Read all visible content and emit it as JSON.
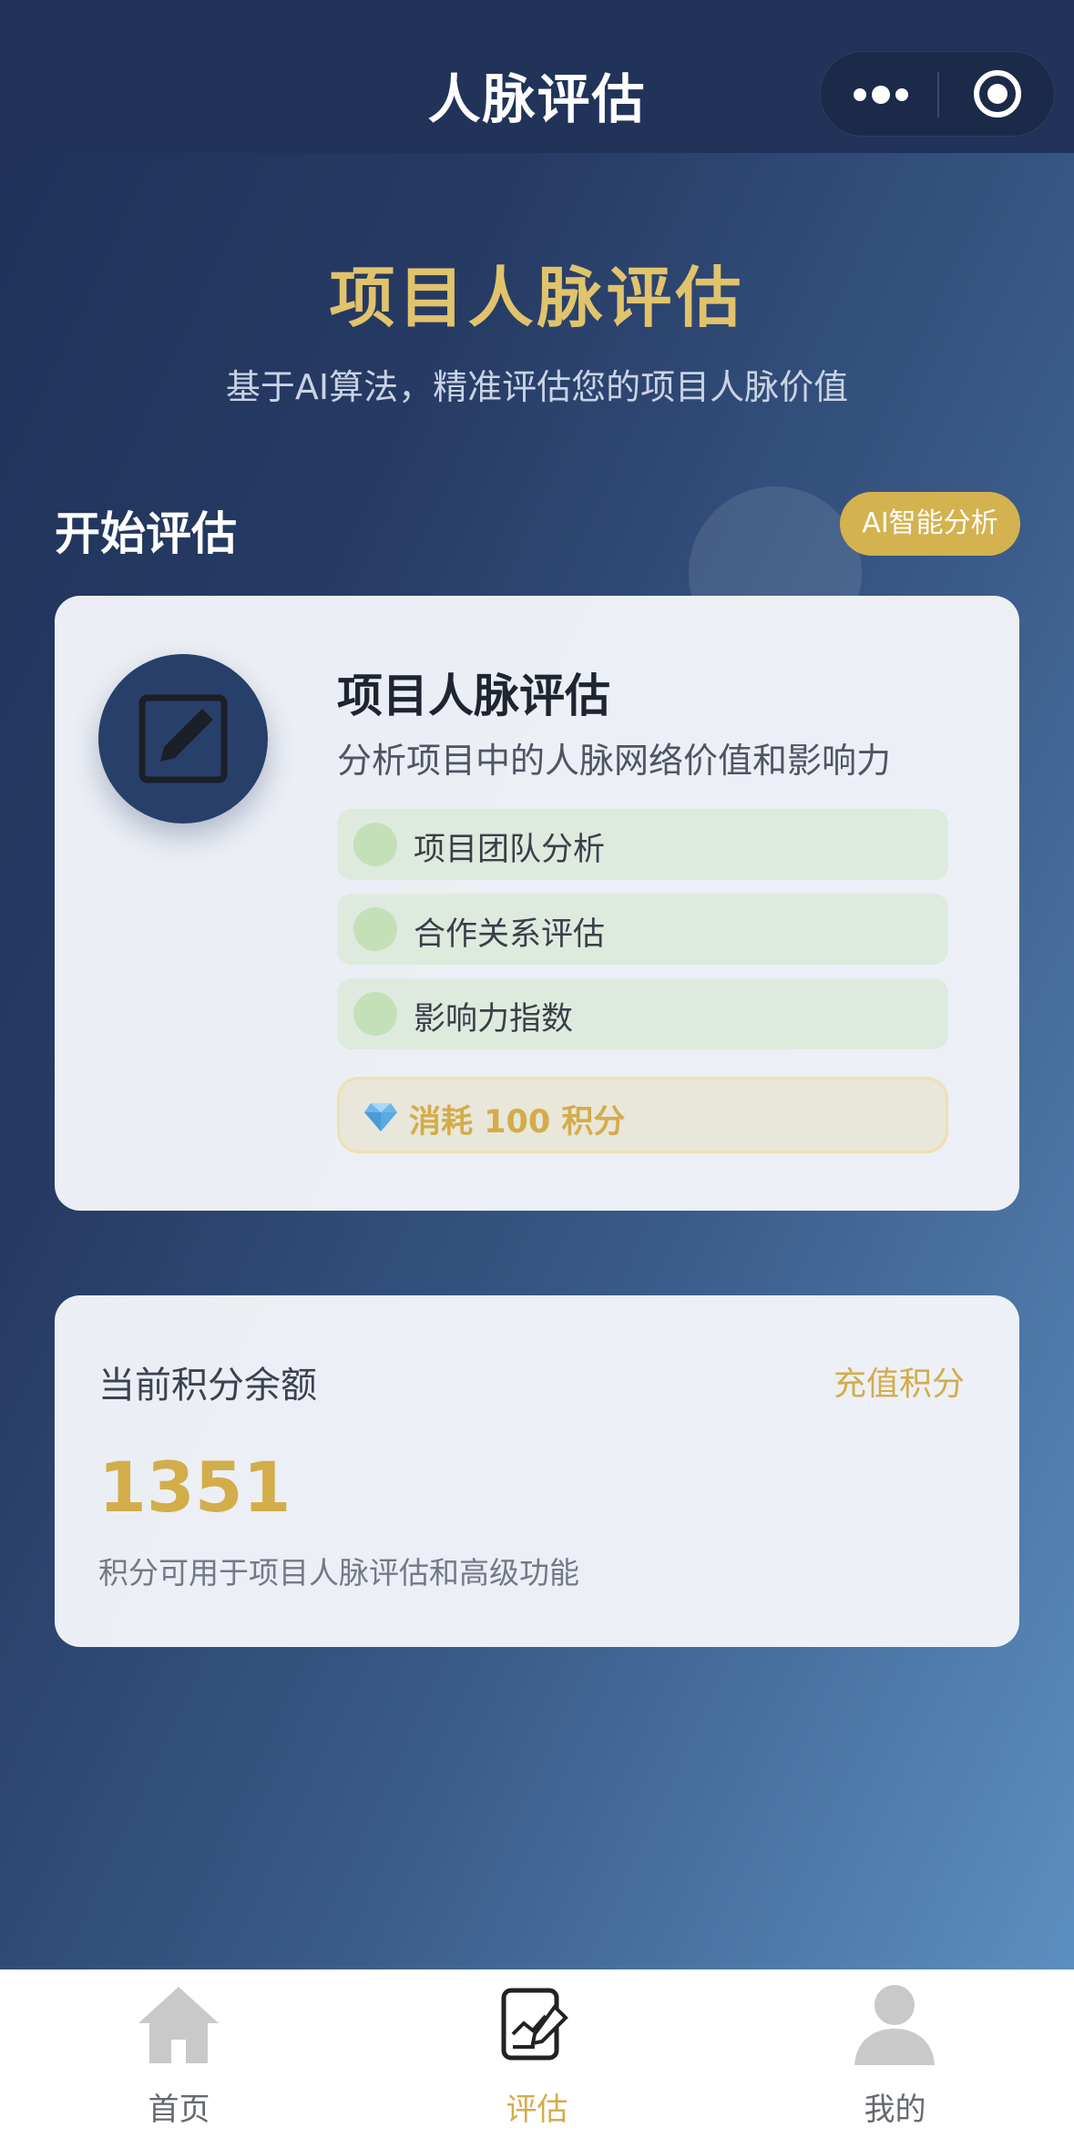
{
  "navbar": {
    "title": "人脉评估",
    "more_icon": "more-dots-icon",
    "close_icon": "target-circle-icon"
  },
  "hero": {
    "title": "项目人脉评估",
    "subtitle": "基于AI算法，精准评估您的项目人脉价值"
  },
  "section": {
    "title": "开始评估",
    "badge": "AI智能分析"
  },
  "assessment_card": {
    "icon": "edit-square-icon",
    "title": "项目人脉评估",
    "description": "分析项目中的人脉网络价值和影响力",
    "features": [
      {
        "label": "项目团队分析"
      },
      {
        "label": "合作关系评估"
      },
      {
        "label": "影响力指数"
      }
    ],
    "cost_icon": "diamond-icon",
    "cost_label": "消耗 100 积分"
  },
  "balance_card": {
    "label": "当前积分余额",
    "recharge_label": "充值积分",
    "value": "1351",
    "note": "积分可用于项目人脉评估和高级功能"
  },
  "tabbar": {
    "tabs": [
      {
        "label": "首页",
        "icon": "home-icon",
        "active": false
      },
      {
        "label": "评估",
        "icon": "assessment-icon",
        "active": true
      },
      {
        "label": "我的",
        "icon": "user-icon",
        "active": false
      }
    ]
  },
  "colors": {
    "accent_gold": "#d3ad4a",
    "nav_bg": "#213358",
    "icon_circle": "#283f6a"
  }
}
